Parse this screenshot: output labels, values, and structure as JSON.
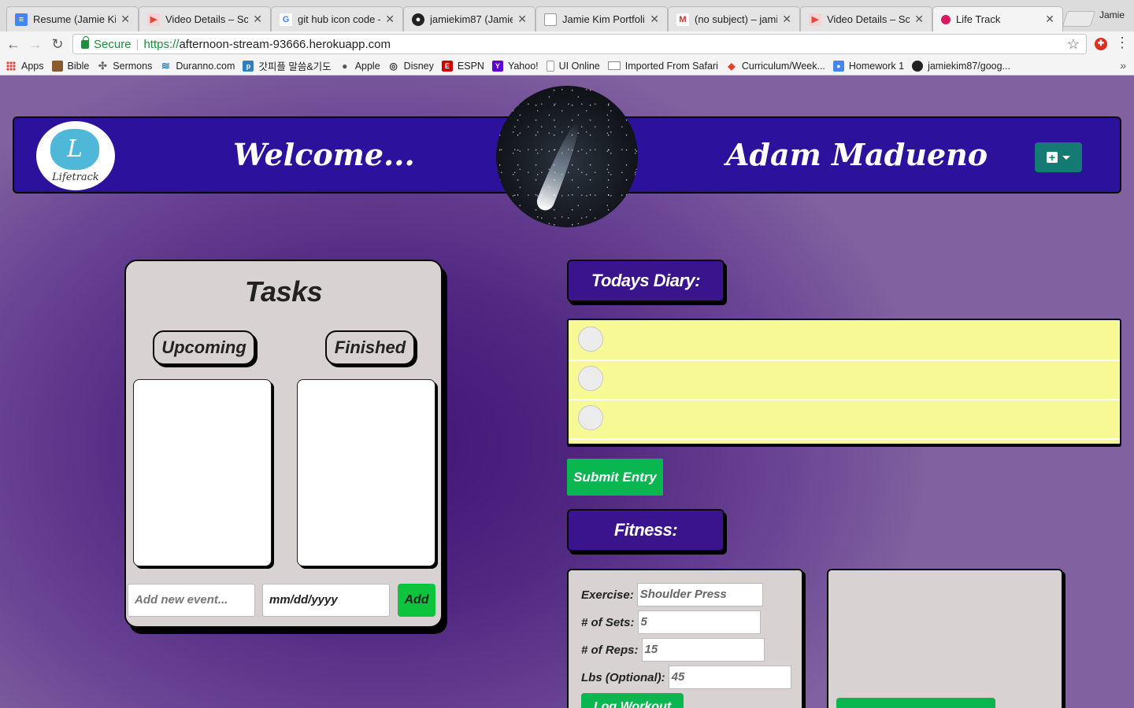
{
  "browser": {
    "tabs": [
      {
        "label": "Resume (Jamie Kim",
        "icon": "docs-icon",
        "color": "#4285f4"
      },
      {
        "label": "Video Details – Scre",
        "icon": "video-icon",
        "color": "#e8453c"
      },
      {
        "label": "git hub icon code –",
        "icon": "google-icon",
        "color": "#4285f4"
      },
      {
        "label": "jamiekim87 (Jamie",
        "icon": "github-icon",
        "color": "#222222"
      },
      {
        "label": "Jamie Kim Portfolio",
        "icon": "page-icon",
        "color": "#888888"
      },
      {
        "label": "(no subject) – jamie",
        "icon": "gmail-icon",
        "color": "#d93025"
      },
      {
        "label": "Video Details – Scre",
        "icon": "video-icon",
        "color": "#e8453c"
      },
      {
        "label": "Life Track",
        "icon": "lifetrack-icon",
        "color": "#d81b60"
      }
    ],
    "profile": "Jamie",
    "secure_label": "Secure",
    "url_scheme": "https://",
    "url_host": "afternoon-stream-93666.herokuapp.com",
    "bookmarks": [
      {
        "label": "Apps",
        "icon": "apps-icon",
        "color": "#e8453c"
      },
      {
        "label": "Bible",
        "icon": "bible-icon",
        "color": "#8a5a2b"
      },
      {
        "label": "Sermons",
        "icon": "sermons-icon",
        "color": "#666666"
      },
      {
        "label": "Duranno.com",
        "icon": "duranno-icon",
        "color": "#2f7fc1"
      },
      {
        "label": "갓피플 말씀&기도",
        "icon": "godpeople-icon",
        "color": "#2f7fc1"
      },
      {
        "label": "Apple",
        "icon": "apple-icon",
        "color": "#555555"
      },
      {
        "label": "Disney",
        "icon": "disney-icon",
        "color": "#333333"
      },
      {
        "label": "ESPN",
        "icon": "espn-icon",
        "color": "#d00000"
      },
      {
        "label": "Yahoo!",
        "icon": "yahoo-icon",
        "color": "#5f01d1"
      },
      {
        "label": "UI Online",
        "icon": "page-icon",
        "color": "#888888"
      },
      {
        "label": "Imported From Safari",
        "icon": "folder-icon",
        "color": "#888888"
      },
      {
        "label": "Curriculum/Week...",
        "icon": "gitlab-icon",
        "color": "#e24329"
      },
      {
        "label": "Homework 1",
        "icon": "homework-icon",
        "color": "#d93025"
      },
      {
        "label": "jamiekim87/goog...",
        "icon": "github-icon",
        "color": "#222222"
      }
    ]
  },
  "app": {
    "logo_letter": "L",
    "logo_text": "Lifetrack",
    "welcome": "Welcome...",
    "username": "Adam Madueno",
    "add_menu_icon": "plus-square-icon",
    "colors": {
      "header": "#2b119c",
      "green": "#0ab650",
      "diary": "#f7fa94"
    }
  },
  "tasks": {
    "title": "Tasks",
    "upcoming_label": "Upcoming",
    "finished_label": "Finished",
    "new_event_placeholder": "Add new event...",
    "date_value": "mm/dd/yyyy",
    "add_label": "Add"
  },
  "diary": {
    "title": "Todays Diary:",
    "submit_label": "Submit Entry"
  },
  "fitness": {
    "title": "Fitness:",
    "exercise_label": "Exercise:",
    "exercise_value": "Shoulder Press",
    "sets_label": "# of Sets:",
    "sets_value": "5",
    "reps_label": "# of Reps:",
    "reps_value": "15",
    "lbs_label": "Lbs (Optional):",
    "lbs_value": "45",
    "log_label": "Log Workout"
  }
}
